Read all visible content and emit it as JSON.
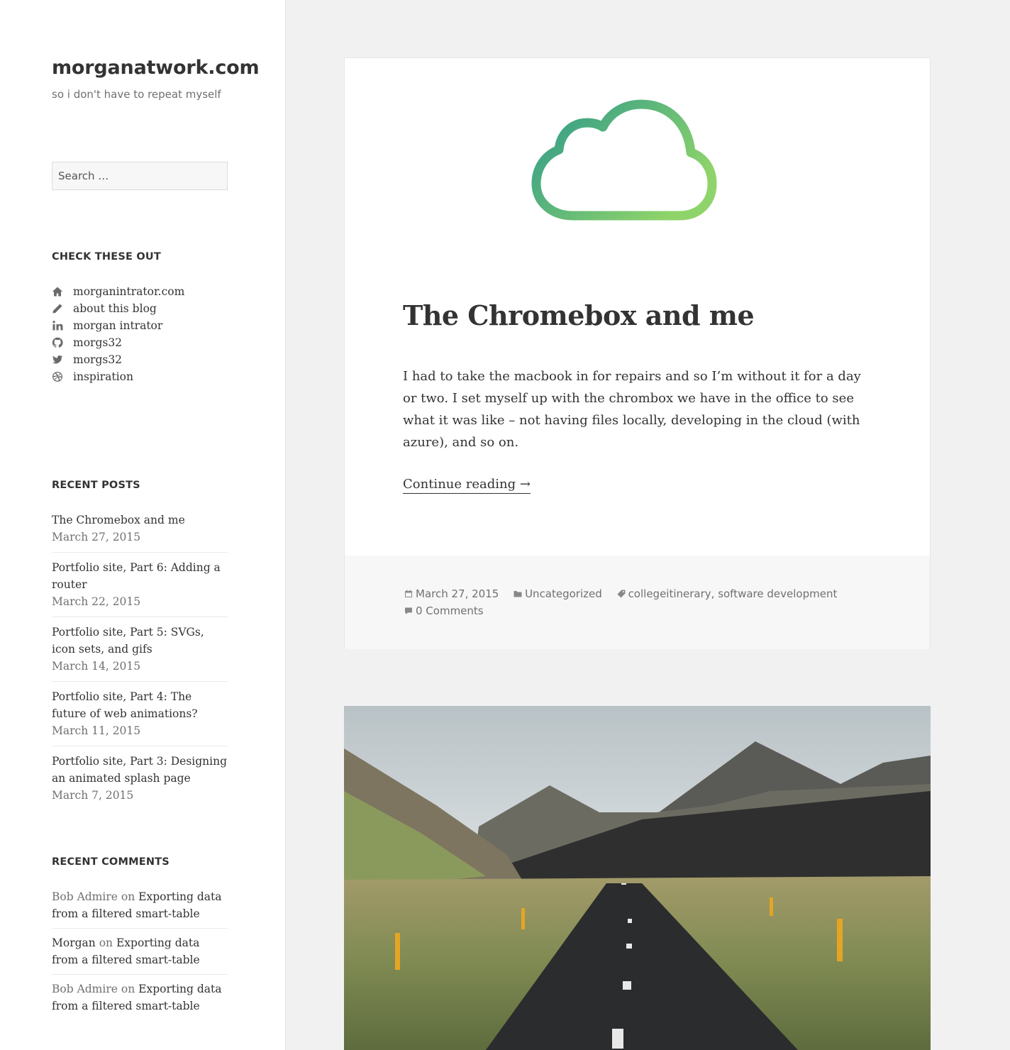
{
  "site": {
    "title": "morganatwork.com",
    "description": "so i don't have to repeat myself"
  },
  "search": {
    "placeholder": "Search …"
  },
  "widgets": {
    "check": {
      "title": "CHECK THESE OUT",
      "items": [
        {
          "label": "morganintrator.com",
          "icon": "home-icon"
        },
        {
          "label": "about this blog",
          "icon": "pencil-icon"
        },
        {
          "label": "morgan intrator",
          "icon": "linkedin-icon"
        },
        {
          "label": "morgs32",
          "icon": "github-icon"
        },
        {
          "label": "morgs32",
          "icon": "twitter-icon"
        },
        {
          "label": "inspiration",
          "icon": "dribbble-icon"
        }
      ]
    },
    "recent_posts": {
      "title": "RECENT POSTS",
      "items": [
        {
          "title": "The Chromebox and me",
          "date": "March 27, 2015"
        },
        {
          "title": "Portfolio site, Part 6: Adding a router",
          "date": "March 22, 2015"
        },
        {
          "title": "Portfolio site, Part 5: SVGs, icon sets, and gifs",
          "date": "March 14, 2015"
        },
        {
          "title": "Portfolio site, Part 4: The future of web animations?",
          "date": "March 11, 2015"
        },
        {
          "title": "Portfolio site, Part 3: Designing an animated splash page",
          "date": "March 7, 2015"
        }
      ]
    },
    "recent_comments": {
      "title": "RECENT COMMENTS",
      "on": "on",
      "items": [
        {
          "author": "Bob Admire",
          "post": "Exporting data from a filtered smart-table"
        },
        {
          "author": "Morgan",
          "post": "Exporting data from a filtered smart-table"
        },
        {
          "author": "Bob Admire",
          "post": "Exporting data from a filtered smart-table"
        }
      ]
    }
  },
  "article": {
    "title": "The Chromebox and me",
    "excerpt": "I had to take the macbook in for repairs and so I’m without it for a day or two. I set myself up with the chrombox we have in the office to see what it was like – not having files locally, developing in the cloud (with azure), and so on.",
    "more": "Continue reading →",
    "meta": {
      "date": "March 27, 2015",
      "category": "Uncategorized",
      "tags": "collegeitinerary, software development",
      "comments": "0 Comments"
    },
    "cloud_gradient": [
      "#2e9a8a",
      "#8fd46a"
    ]
  }
}
